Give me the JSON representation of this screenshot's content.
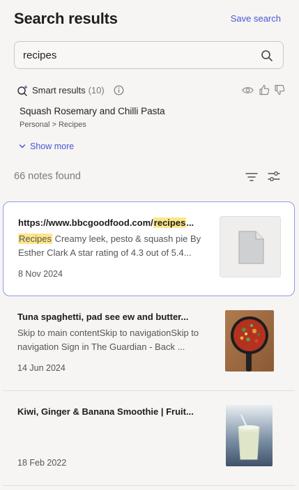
{
  "header": {
    "title": "Search results",
    "save_search_label": "Save search"
  },
  "search": {
    "value": "recipes",
    "placeholder": ""
  },
  "smart_results": {
    "label": "Smart results",
    "count": "(10)",
    "top_result": {
      "title": "Squash Rosemary and Chilli Pasta",
      "path": "Personal > Recipes"
    },
    "show_more_label": "Show more"
  },
  "notes": {
    "count_label": "66 notes found",
    "items": [
      {
        "title_pre": "https://www.bbcgoodfood.com/",
        "title_hl": "recipes",
        "title_post": "...",
        "snippet_hl": "Recipes",
        "snippet": " Creamy leek, pesto & squash pie By Esther Clark A star rating of 4.3 out of 5.4...",
        "date": "8 Nov 2024",
        "thumbnail": "document-icon"
      },
      {
        "title": "Tuna spaghetti, pad see ew and butter...",
        "snippet": "Skip to main contentSkip to navigationSkip to navigation Sign in The Guardian - Back ...",
        "date": "14 Jun 2024",
        "thumbnail": "skillet-dish-photo"
      },
      {
        "title": "Kiwi, Ginger & Banana Smoothie | Fruit...",
        "snippet": "",
        "date": "18 Feb 2022",
        "thumbnail": "smoothie-glass-photo"
      }
    ]
  },
  "colors": {
    "accent": "#4a55d6",
    "highlight": "#fde68a",
    "selected_border": "#8f97e8",
    "background": "#f6f5f3"
  }
}
